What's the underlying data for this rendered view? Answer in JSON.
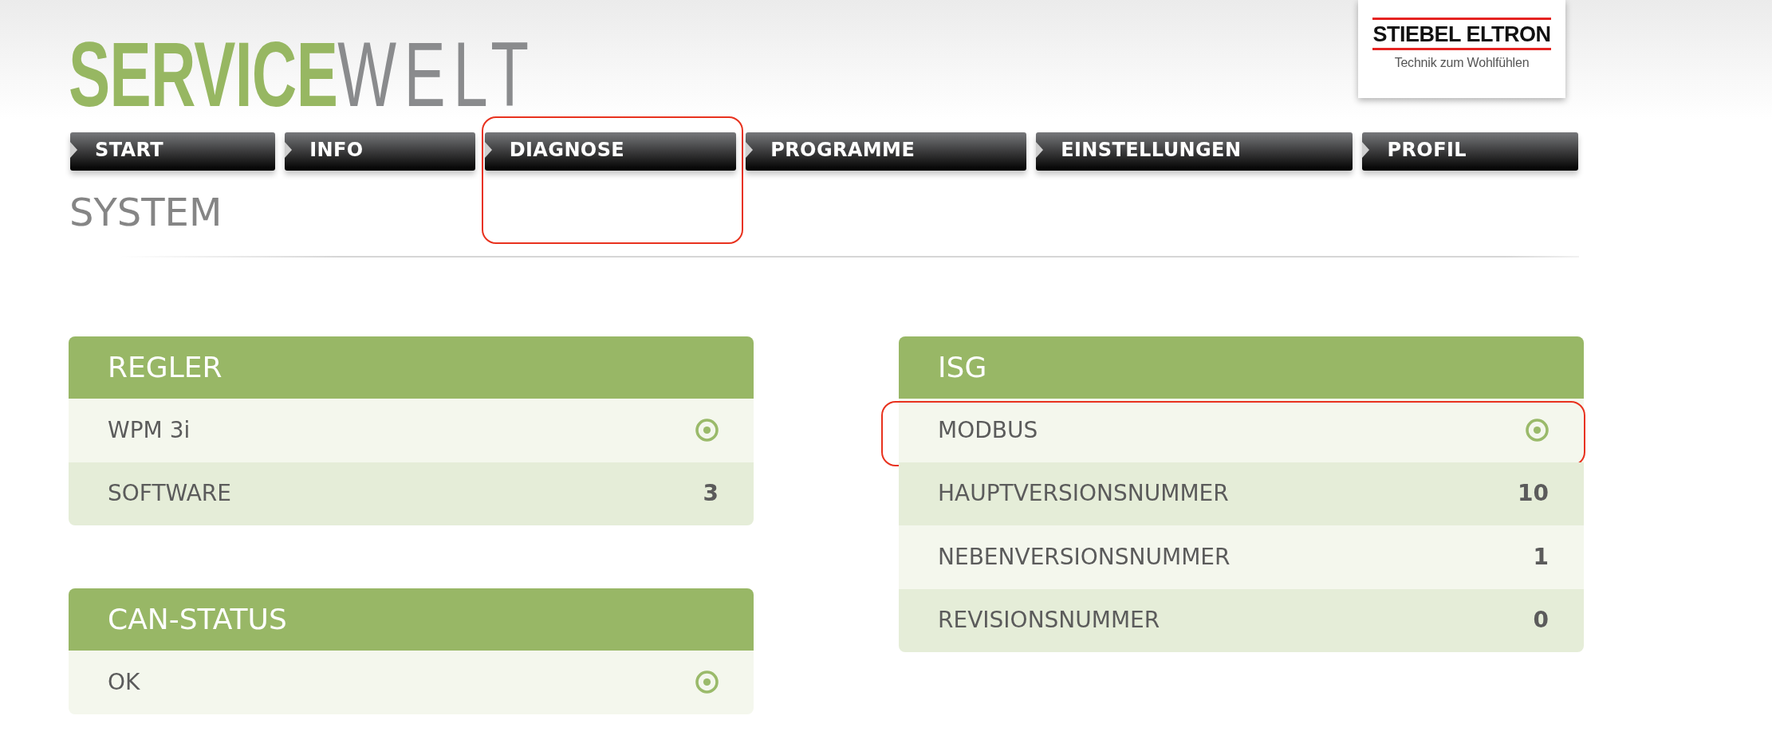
{
  "header": {
    "logo": "**SERVICE**WELT",
    "brand_logo": {
      "name": "STIEBEL ELTRON",
      "tagline": "Technik zum Wohlfühlen"
    }
  },
  "nav_tabs": [
    {
      "label": "START",
      "highlighted": false
    },
    {
      "label": "INFO",
      "highlighted": false
    },
    {
      "label": "DIAGNOSE",
      "highlighted": true
    },
    {
      "label": "PROGRAMME",
      "highlighted": false
    },
    {
      "label": "EINSTELLUNGEN",
      "highlighted": false
    },
    {
      "label": "PROFIL",
      "highlighted": false
    }
  ],
  "page_title": "SYSTEM",
  "columns": [
    {
      "panels": [
        {
          "title": "REGLER",
          "rows": [
            {
              "label": "WPM 3i",
              "kind": "status",
              "highlighted": false
            },
            {
              "label": "SOFTWARE",
              "kind": "value",
              "value": "3",
              "highlighted": false
            }
          ]
        },
        {
          "title": "CAN-STATUS",
          "rows": [
            {
              "label": "OK",
              "kind": "status",
              "highlighted": false
            }
          ]
        }
      ]
    },
    {
      "panels": [
        {
          "title": "ISG",
          "rows": [
            {
              "label": "MODBUS",
              "kind": "status",
              "highlighted": true
            },
            {
              "label": "HAUPTVERSIONSNUMMER",
              "kind": "value",
              "value": "10",
              "highlighted": false
            },
            {
              "label": "NEBENVERSIONSNUMMER",
              "kind": "value",
              "value": "1",
              "highlighted": false
            },
            {
              "label": "REVISIONSNUMMER",
              "kind": "value",
              "value": "0",
              "highlighted": false
            }
          ]
        }
      ]
    }
  ]
}
